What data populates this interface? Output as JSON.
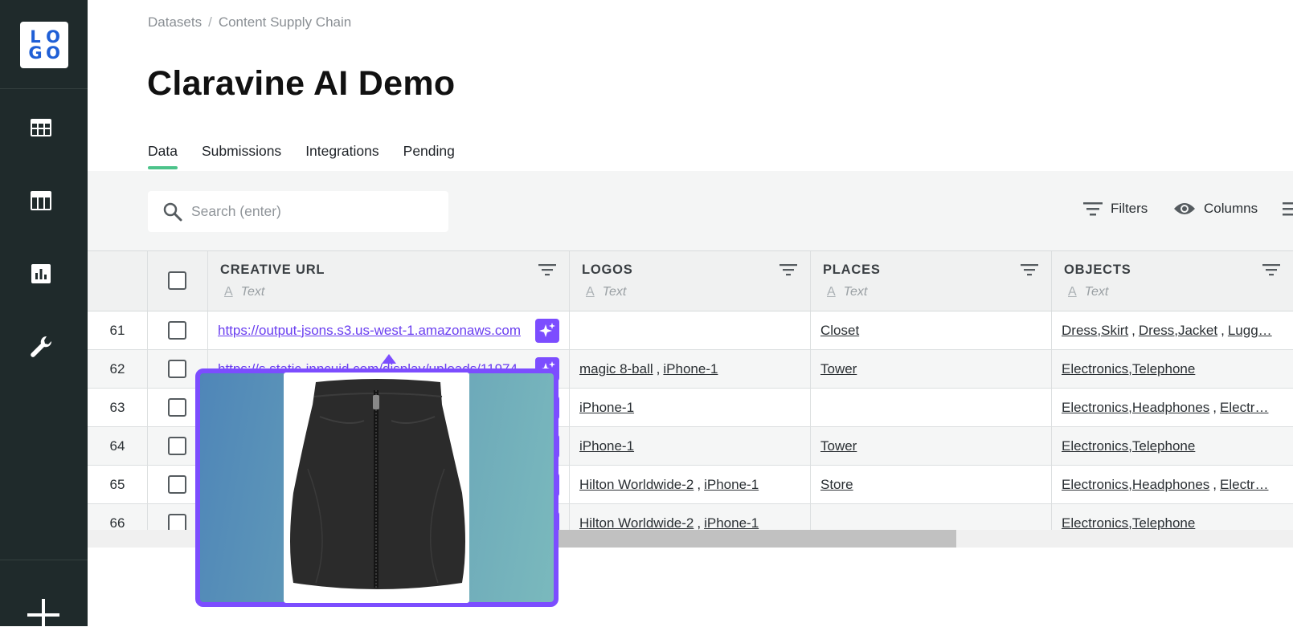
{
  "sidebar": {
    "logo_letters": [
      "L",
      "O",
      "G",
      "O"
    ],
    "nav_items": [
      {
        "name": "table-icon"
      },
      {
        "name": "board-icon"
      },
      {
        "name": "chart-icon"
      },
      {
        "name": "wrench-icon"
      }
    ],
    "bottom_action": "plus-icon"
  },
  "breadcrumb": {
    "root": "Datasets",
    "separator": "/",
    "current": "Content Supply Chain"
  },
  "page_title": "Claravine AI Demo",
  "tabs": [
    {
      "label": "Data",
      "active": true
    },
    {
      "label": "Submissions",
      "active": false
    },
    {
      "label": "Integrations",
      "active": false
    },
    {
      "label": "Pending",
      "active": false
    }
  ],
  "toolbar": {
    "search_placeholder": "Search (enter)",
    "filters_label": "Filters",
    "columns_label": "Columns"
  },
  "columns": [
    {
      "name": "CREATIVE URL",
      "type": "Text"
    },
    {
      "name": "LOGOS",
      "type": "Text"
    },
    {
      "name": "PLACES",
      "type": "Text"
    },
    {
      "name": "OBJECTS",
      "type": "Text"
    }
  ],
  "rows": [
    {
      "num": "61",
      "url": "https://output-jsons.s3.us-west-1.amazonaws.com",
      "logos": [],
      "places": [
        "Closet"
      ],
      "objects": [
        "Dress,Skirt",
        "Dress,Jacket",
        "Lugg…"
      ]
    },
    {
      "num": "62",
      "url": "https://s.static-inncuid.com/display/uploads/11974",
      "logos": [
        "magic 8-ball",
        "iPhone-1"
      ],
      "places": [
        "Tower"
      ],
      "objects": [
        "Electronics,Telephone"
      ]
    },
    {
      "num": "63",
      "url": "",
      "logos": [
        "iPhone-1"
      ],
      "places": [],
      "objects": [
        "Electronics,Headphones",
        "Electr…"
      ]
    },
    {
      "num": "64",
      "url": "",
      "logos": [
        "iPhone-1"
      ],
      "places": [
        "Tower"
      ],
      "objects": [
        "Electronics,Telephone"
      ]
    },
    {
      "num": "65",
      "url": "",
      "logos": [
        "Hilton Worldwide-2",
        "iPhone-1"
      ],
      "places": [
        "Store"
      ],
      "objects": [
        "Electronics,Headphones",
        "Electr…"
      ]
    },
    {
      "num": "66",
      "url": "",
      "logos": [
        "Hilton Worldwide-2",
        "iPhone-1"
      ],
      "places": [],
      "objects": [
        "Electronics,Telephone"
      ]
    }
  ],
  "colors": {
    "sidebar_bg": "#1f2a2b",
    "accent_purple": "#7c4dff",
    "tab_underline": "#4cc38a",
    "logo_blue": "#1f5fd6"
  },
  "popover": {
    "image": "black-leather-mini-skirt"
  }
}
